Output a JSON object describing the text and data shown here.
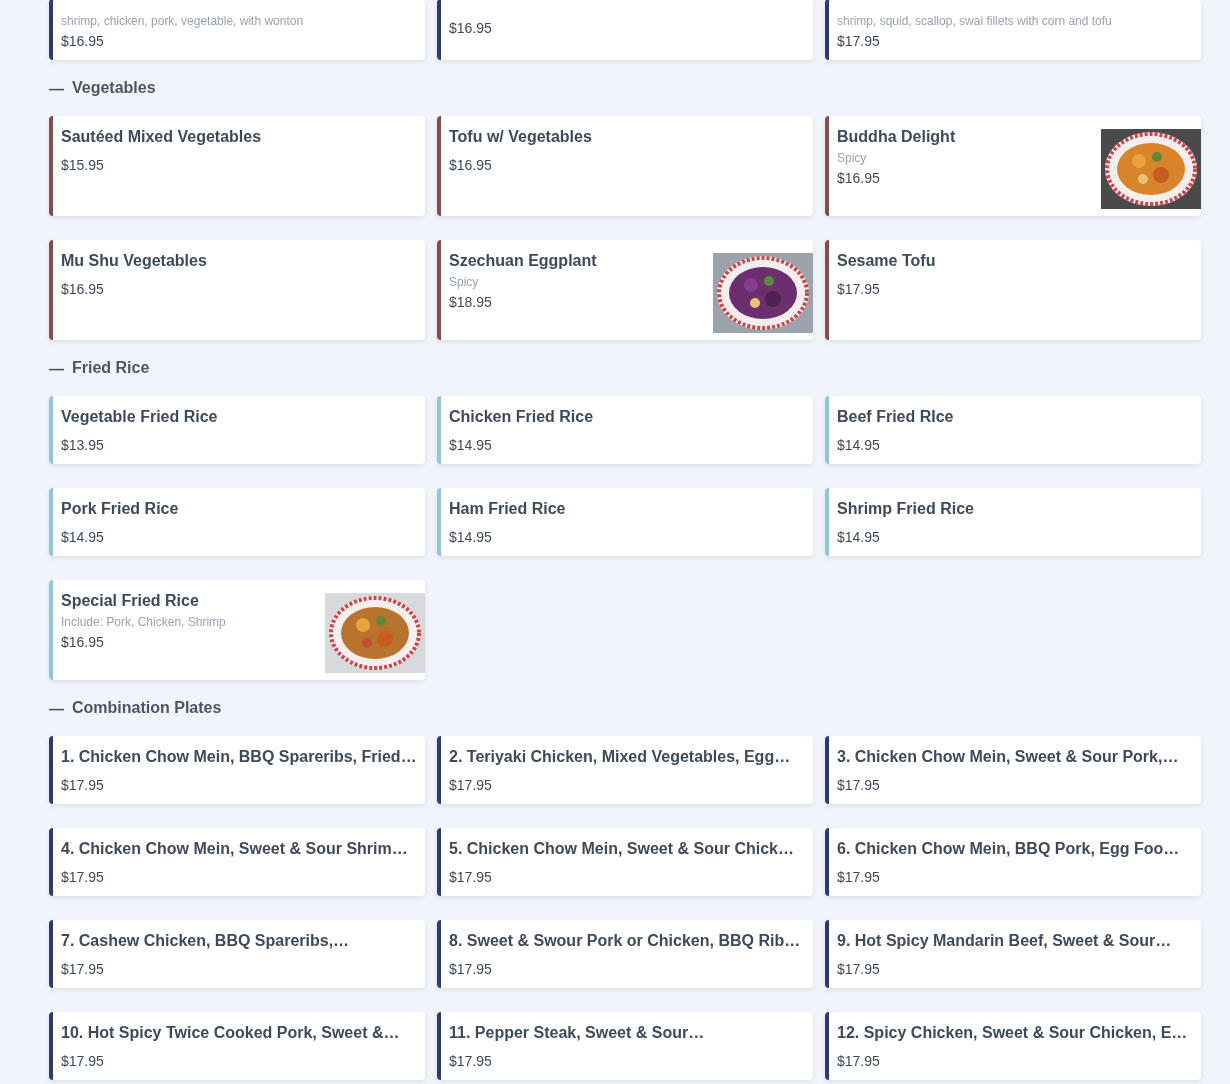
{
  "sections": [
    {
      "color": "#2c3b6e",
      "items": [
        {
          "description": "shrimp, chicken, pork, vegetable, with wonton",
          "price": "$16.95"
        },
        {
          "price": "$16.95"
        },
        {
          "description": "shrimp, squid, scallop, swai fillets with corn and tofu",
          "price": "$17.95"
        }
      ]
    },
    {
      "toggle": "—",
      "title": "Vegetables",
      "color": "#8a4a4a",
      "items": [
        {
          "name": "Sautéed Mixed Vegetables",
          "price": "$15.95"
        },
        {
          "name": "Tofu w/ Vegetables",
          "price": "$16.95"
        },
        {
          "name": "Buddha Delight",
          "description": "Spicy",
          "price": "$16.95"
        },
        {
          "name": "Mu Shu Vegetables",
          "price": "$16.95"
        },
        {
          "name": "Szechuan Eggplant",
          "description": "Spicy",
          "price": "$18.95"
        },
        {
          "name": "Sesame Tofu",
          "price": "$17.95"
        }
      ]
    },
    {
      "toggle": "—",
      "title": "Fried Rice",
      "color": "#8fc6dd",
      "items": [
        {
          "name": "Vegetable Fried Rice",
          "price": "$13.95"
        },
        {
          "name": "Chicken Fried Rice",
          "price": "$14.95"
        },
        {
          "name": "Beef Fried RIce",
          "price": "$14.95"
        },
        {
          "name": "Pork Fried Rice",
          "price": "$14.95"
        },
        {
          "name": "Ham Fried Rice",
          "price": "$14.95"
        },
        {
          "name": "Shrimp Fried Rice",
          "price": "$14.95"
        },
        {
          "name": "Special Fried Rice",
          "description": "Include: Pork, Chicken, Shrimp",
          "price": "$16.95"
        }
      ]
    },
    {
      "toggle": "—",
      "title": "Combination Plates",
      "color": "#2c3b6e",
      "items": [
        {
          "name": "1. Chicken Chow Mein, BBQ Spareribs, Fried…",
          "price": "$17.95"
        },
        {
          "name": "2. Teriyaki Chicken, Mixed Vegetables, Egg…",
          "price": "$17.95"
        },
        {
          "name": "3. Chicken Chow Mein, Sweet & Sour Pork,…",
          "price": "$17.95"
        },
        {
          "name": "4. Chicken Chow Mein, Sweet & Sour Shrim…",
          "price": "$17.95"
        },
        {
          "name": "5. Chicken Chow Mein, Sweet & Sour Chick…",
          "price": "$17.95"
        },
        {
          "name": "6. Chicken Chow Mein, BBQ Pork, Egg Foo…",
          "price": "$17.95"
        },
        {
          "name": "7. Cashew Chicken, BBQ Spareribs,…",
          "price": "$17.95"
        },
        {
          "name": "8. Sweet & Swour Pork or Chicken, BBQ Rib…",
          "price": "$17.95"
        },
        {
          "name": "9. Hot Spicy Mandarin Beef, Sweet & Sour…",
          "price": "$17.95"
        },
        {
          "name": "10. Hot Spicy Twice Cooked Pork, Sweet &…",
          "price": "$17.95"
        },
        {
          "name": "11. Pepper Steak, Sweet & Sour…",
          "price": "$17.95"
        },
        {
          "name": "12. Spicy Chicken, Sweet & Sour Chicken, E…",
          "price": "$17.95"
        }
      ]
    }
  ]
}
